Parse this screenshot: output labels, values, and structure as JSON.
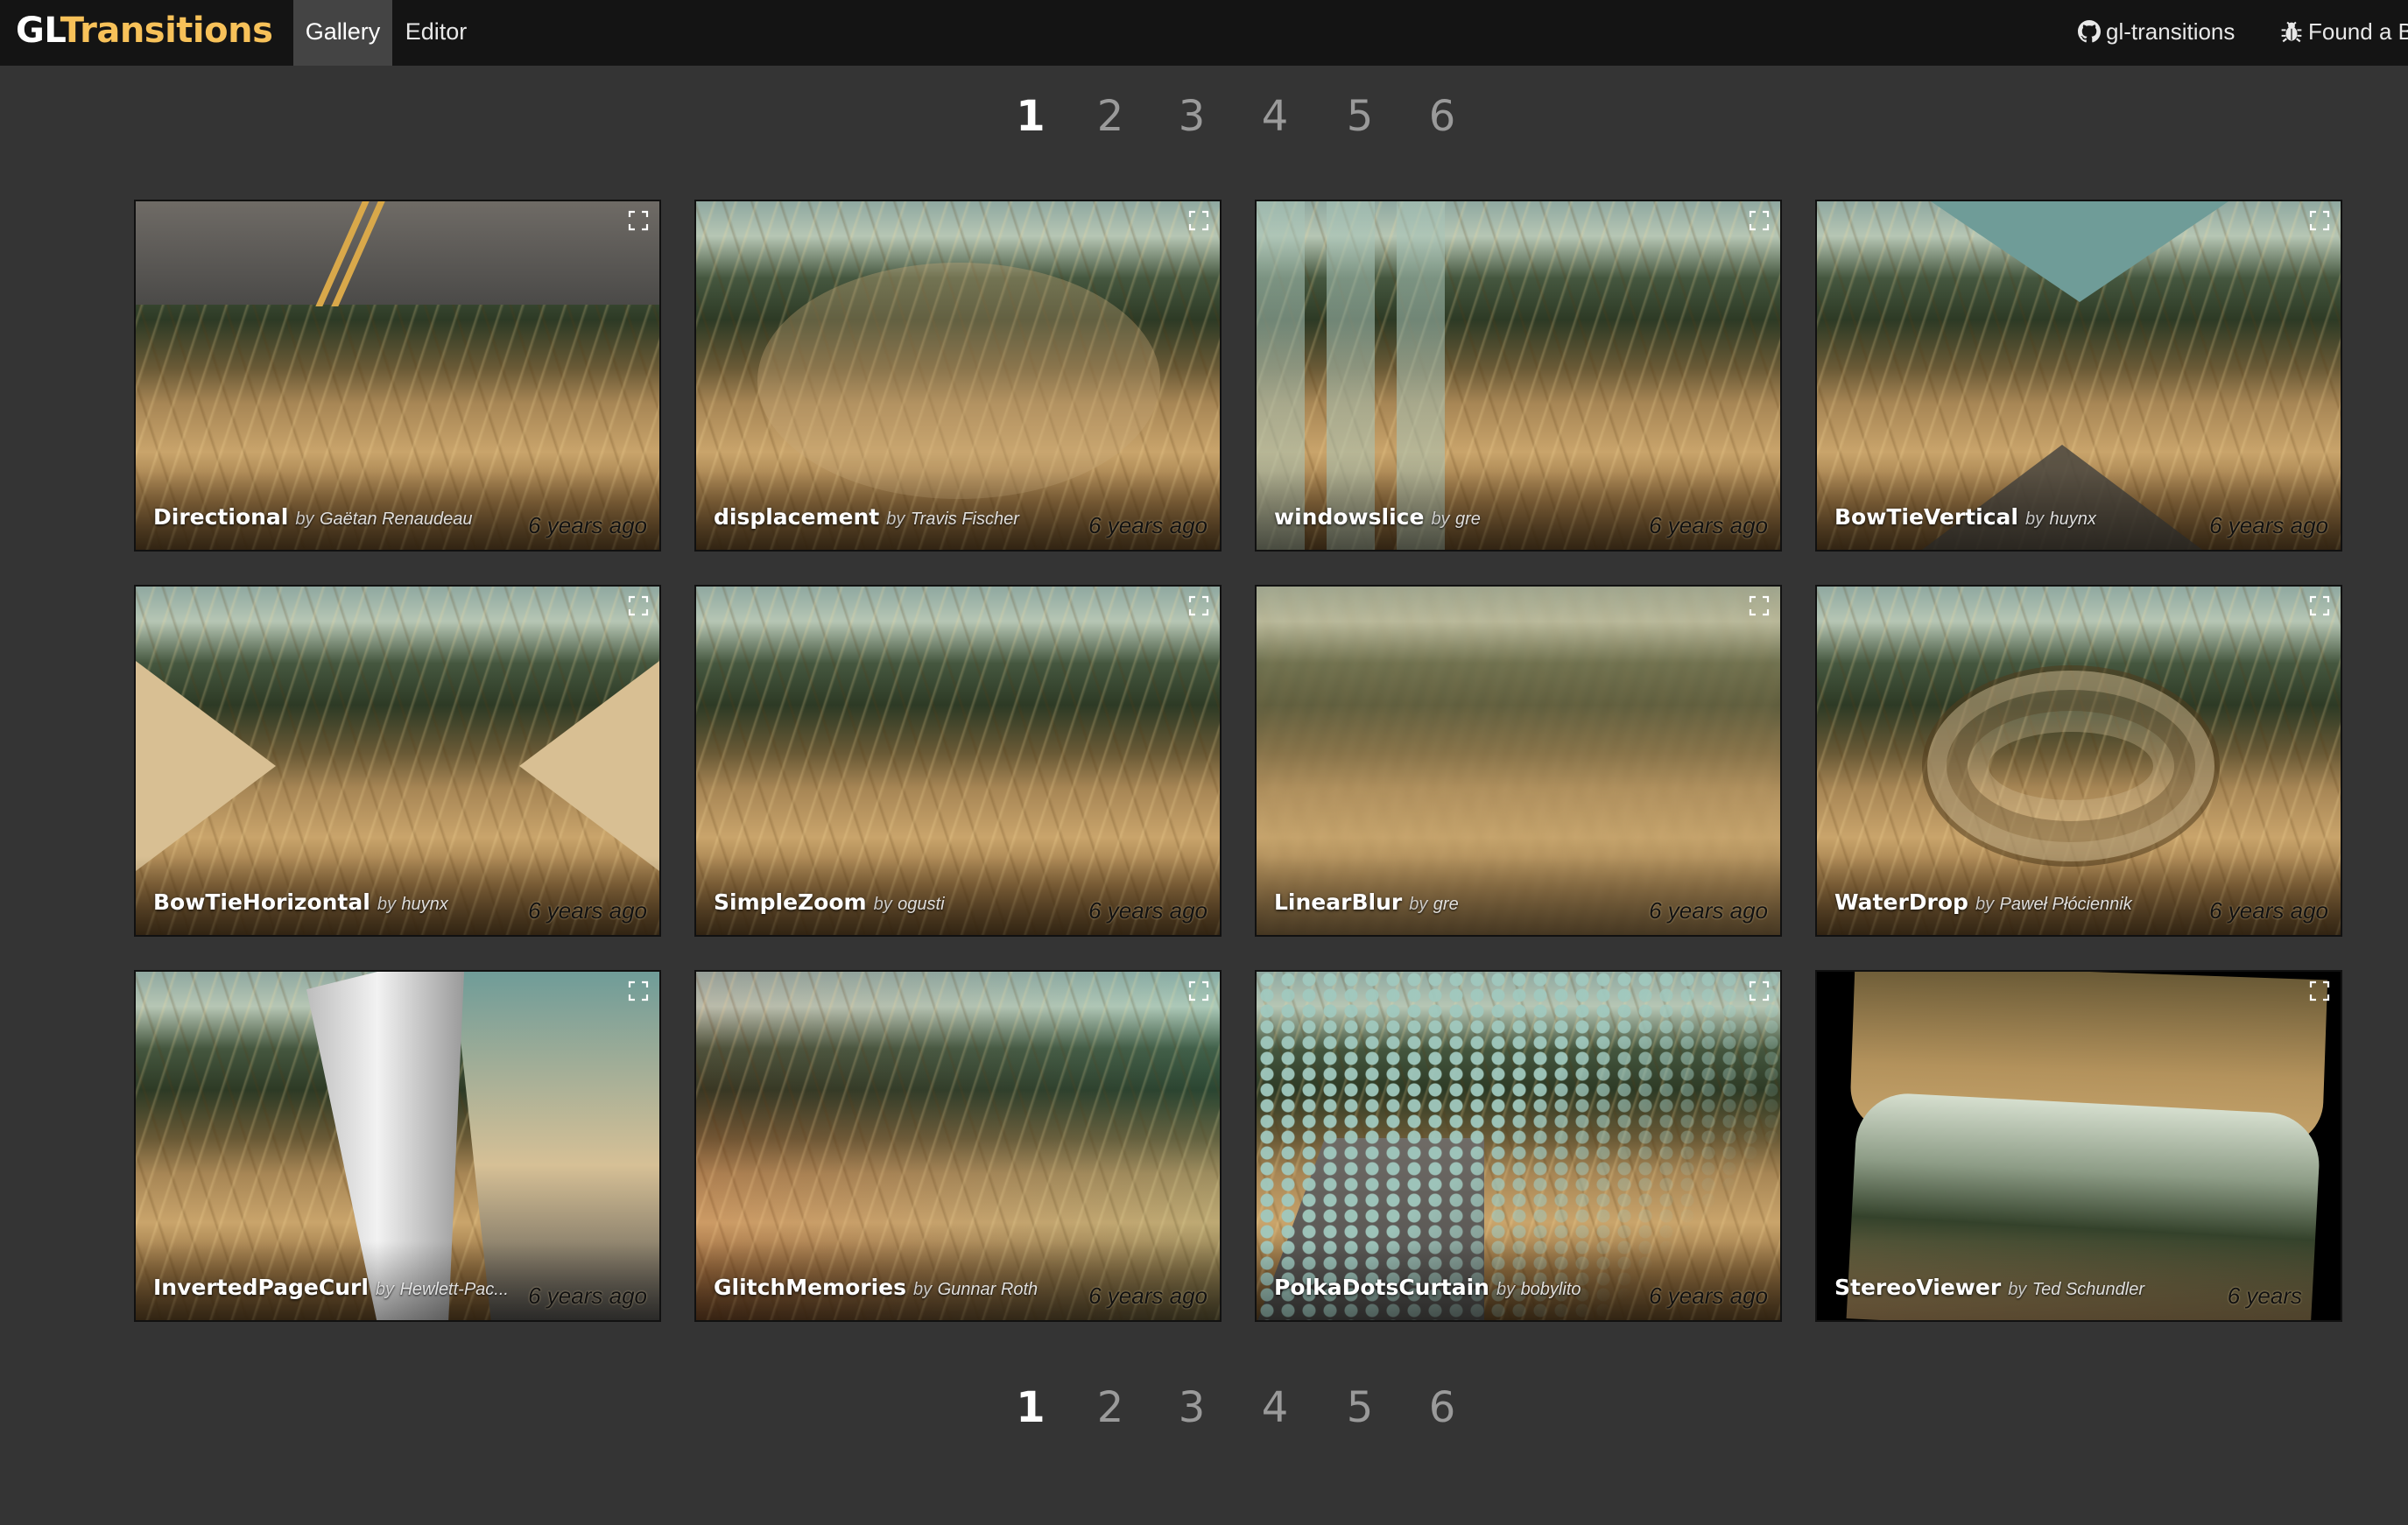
{
  "header": {
    "logo_gl": "GL",
    "logo_transitions": "Transitions",
    "tabs": [
      {
        "label": "Gallery",
        "active": true
      },
      {
        "label": "Editor",
        "active": false
      }
    ],
    "links": {
      "github": "gl-transitions",
      "bug": "Found a B"
    }
  },
  "pagination": {
    "current": 1,
    "pages": [
      "1",
      "2",
      "3",
      "4",
      "5",
      "6"
    ]
  },
  "cards": [
    {
      "name": "Directional",
      "by": "by",
      "author": "Gaëtan Renaudeau",
      "age": "6 years ago"
    },
    {
      "name": "displacement",
      "by": "by",
      "author": "Travis Fischer",
      "age": "6 years ago"
    },
    {
      "name": "windowslice",
      "by": "by",
      "author": "gre",
      "age": "6 years ago"
    },
    {
      "name": "BowTieVertical",
      "by": "by",
      "author": "huynx",
      "age": "6 years ago"
    },
    {
      "name": "BowTieHorizontal",
      "by": "by",
      "author": "huynx",
      "age": "6 years ago"
    },
    {
      "name": "SimpleZoom",
      "by": "by",
      "author": "ogusti",
      "age": "6 years ago"
    },
    {
      "name": "LinearBlur",
      "by": "by",
      "author": "gre",
      "age": "6 years ago"
    },
    {
      "name": "WaterDrop",
      "by": "by",
      "author": "Paweł Płóciennik",
      "age": "6 years ago"
    },
    {
      "name": "InvertedPageCurl",
      "by": "by",
      "author": "Hewlett-Pac...",
      "age": "6 years ago"
    },
    {
      "name": "GlitchMemories",
      "by": "by",
      "author": "Gunnar Roth",
      "age": "6 years ago"
    },
    {
      "name": "PolkaDotsCurtain",
      "by": "by",
      "author": "bobylito",
      "age": "6 years ago"
    },
    {
      "name": "StereoViewer",
      "by": "by",
      "author": "Ted Schundler",
      "age": "6 years"
    }
  ],
  "colors": {
    "background": "#343434",
    "topbar": "#141414",
    "active_tab": "#444444",
    "logo_accent": "#f7c159"
  },
  "icons": {
    "github": "github-icon",
    "bug": "bug-icon",
    "fullscreen": "fullscreen-icon"
  }
}
